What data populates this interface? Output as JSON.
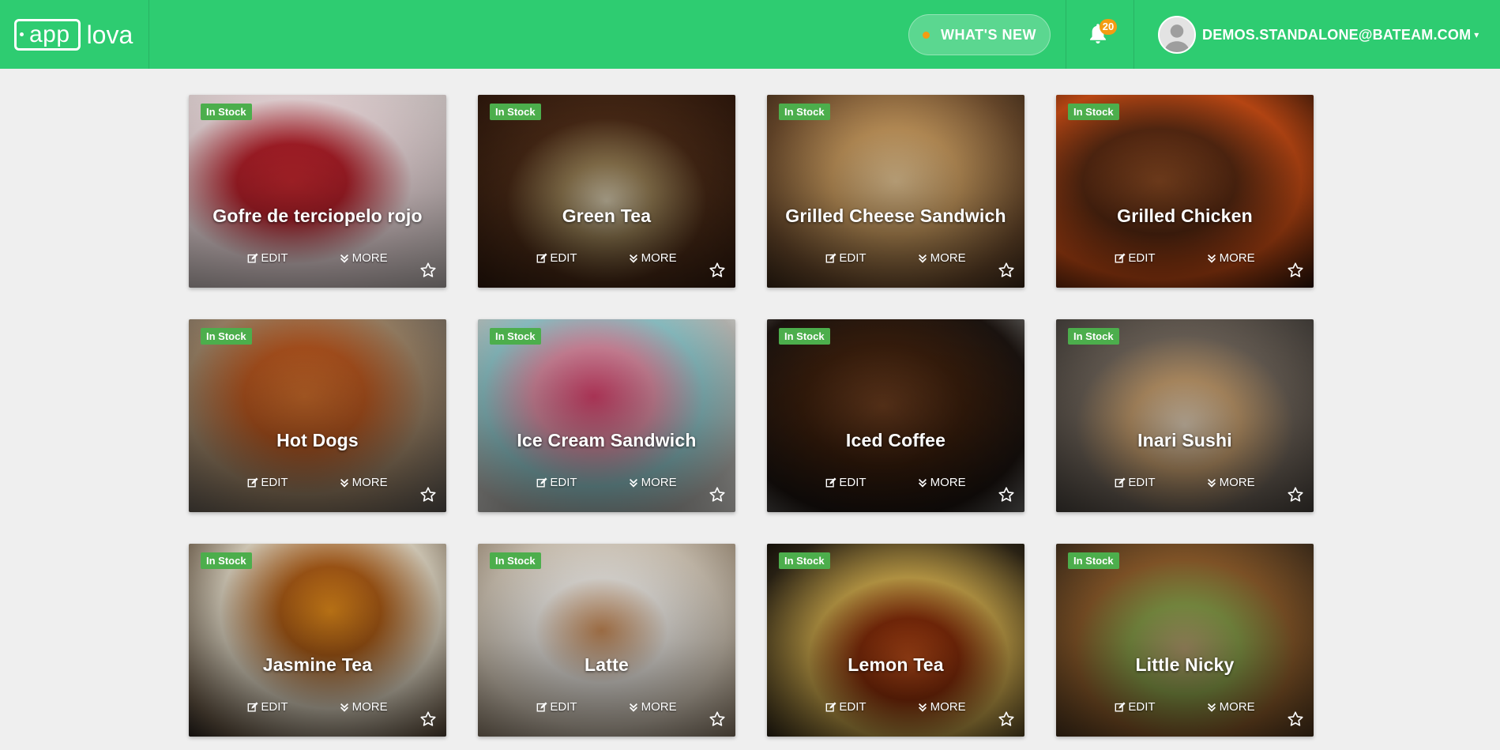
{
  "header": {
    "logo_part1": "app",
    "logo_part2": "lova",
    "whats_new_label": "WHAT'S NEW",
    "notification_count": "20",
    "user_email": "DEMOS.STANDALONE@BATEAM.COM",
    "brand_color": "#2ecc71"
  },
  "card_actions": {
    "edit_label": "EDIT",
    "more_label": "MORE"
  },
  "items": [
    {
      "name": "Gofre de terciopelo rojo",
      "stock": "In Stock",
      "bg": "radial-gradient(ellipse at 40% 45%, #c8282f 0%, #b5202a 25%, #e8d6d8 55%, #bdb6b4 100%)"
    },
    {
      "name": "Green Tea",
      "stock": "In Stock",
      "bg": "radial-gradient(ellipse at 50% 55%, #d9cdb0 0%, #9a8156 25%, #4a2a16 55%, #2b160b 100%)"
    },
    {
      "name": "Grilled Cheese Sandwich",
      "stock": "In Stock",
      "bg": "radial-gradient(ellipse at 50% 45%, #e8c896 0%, #c89a5e 35%, #6b4a2c 75%, #3a2818 100%)"
    },
    {
      "name": "Grilled Chicken",
      "stock": "In Stock",
      "bg": "radial-gradient(ellipse at 40% 45%, #8a4a22 0%, #5a2a12 35%, #c24a14 65%, #2a1208 100%)"
    },
    {
      "name": "Hot Dogs",
      "stock": "In Stock",
      "bg": "radial-gradient(ellipse at 45% 40%, #c86a2a 0%, #b3551f 30%, #9a8266 60%, #5a5652 100%)"
    },
    {
      "name": "Ice Cream Sandwich",
      "stock": "In Stock",
      "bg": "radial-gradient(ellipse at 45% 40%, #d4406a 0%, #d88aa0 30%, #8ec4c8 55%, #b8b8b4 80%, #e6e4e0 100%)"
    },
    {
      "name": "Iced Coffee",
      "stock": "In Stock",
      "bg": "radial-gradient(ellipse at 45% 45%, #6a3c1e 0%, #3a1e0c 40%, #1c1410 75%, #6a6a68 100%)"
    },
    {
      "name": "Inari Sushi",
      "stock": "In Stock",
      "bg": "radial-gradient(ellipse at 50% 55%, #e4d2ba 0%, #c8a070 30%, #6c6258 60%, #3e3a36 100%)"
    },
    {
      "name": "Jasmine Tea",
      "stock": "In Stock",
      "bg": "radial-gradient(ellipse at 55% 35%, #e08a1a 0%, #a85a16 25%, #d8cfbc 55%, #6a5a48 85%, #2a2420 100%)"
    },
    {
      "name": "Latte",
      "stock": "In Stock",
      "bg": "radial-gradient(ellipse at 48% 45%, #c88a56 0%, #eae6e0 35%, #cfc4b4 65%, #8a7a66 100%)"
    },
    {
      "name": "Lemon Tea",
      "stock": "In Stock",
      "bg": "radial-gradient(ellipse at 55% 60%, #c2501a 0%, #8a2e0a 25%, #c7a44a 50%, #2c2416 85%, #141008 100%)"
    },
    {
      "name": "Little Nicky",
      "stock": "In Stock",
      "bg": "radial-gradient(ellipse at 50% 55%, #b8a070 0%, #8aa04a 30%, #8a5a2a 60%, #3a2a1a 100%)"
    }
  ]
}
